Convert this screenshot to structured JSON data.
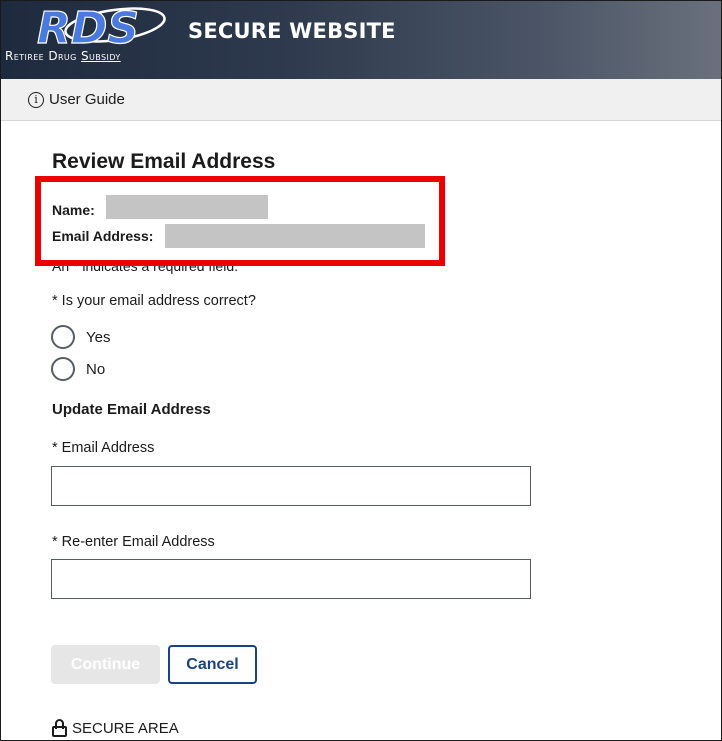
{
  "header": {
    "logo_text": "RDS",
    "logo_subtitle": "Retiree Drug Subsidy",
    "site_title": "SECURE WEBSITE"
  },
  "toolbar": {
    "user_guide_label": "User Guide",
    "info_icon": "info-icon"
  },
  "page": {
    "title": "Review Email Address",
    "name_label": "Name:",
    "email_label": "Email Address:",
    "required_note": "An * indicates a required field.",
    "question": "* Is your email address correct?",
    "options": [
      "Yes",
      "No"
    ],
    "update_section_title": "Update Email Address",
    "email_field_label": "* Email Address",
    "email_field_value": "",
    "reenter_field_label": "* Re-enter Email Address",
    "reenter_field_value": ""
  },
  "actions": {
    "continue_label": "Continue",
    "cancel_label": "Cancel"
  },
  "footer": {
    "secure_area_label": "SECURE AREA",
    "lock_icon": "lock-icon"
  },
  "colors": {
    "highlight_border": "#ee0000",
    "cancel_accent": "#1a4480",
    "redacted": "#c4c4c4"
  }
}
